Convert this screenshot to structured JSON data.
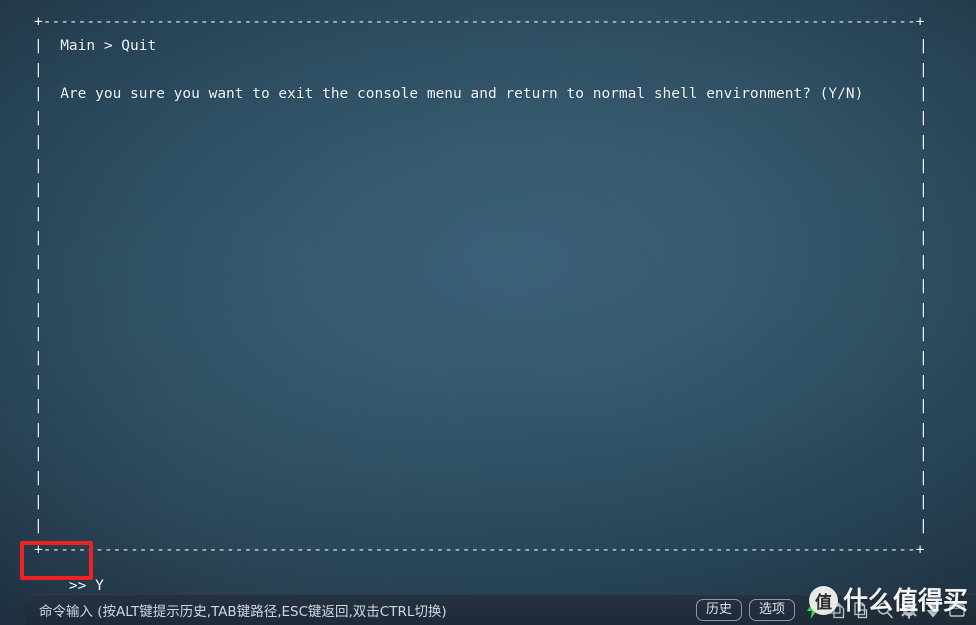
{
  "window": {
    "background_color": "#2e4e62",
    "text_color": "#f4f8fa"
  },
  "console": {
    "border_corner_char": "+",
    "border_horizontal_char": "-",
    "border_vertical_char": "|",
    "top_border": "+---------------------------------------------------------------------------------------------------------+",
    "bottom_border": "+---------------------------------------------------------------------------------------------------------+",
    "breadcrumb": "Main > Quit",
    "question": "Are you sure you want to exit the console menu and return to normal shell environment? (Y/N)",
    "blank_rows_after_question": 18,
    "rows": [
      "Main > Quit",
      "",
      "Are you sure you want to exit the console menu and return to normal shell environment? (Y/N)"
    ]
  },
  "prompt": {
    "symbol": ">>",
    "value": "Y",
    "full_text": ">> Y"
  },
  "annotation": {
    "color": "#ee2222",
    "target": "prompt-line"
  },
  "bottom_bar": {
    "placeholder": "命令输入 (按ALT键提示历史,TAB键路径,ESC键返回,双击CTRL切换)",
    "buttons": [
      {
        "label": "历史",
        "name": "history-button"
      },
      {
        "label": "选项",
        "name": "options-button"
      }
    ],
    "icons": [
      {
        "name": "lightning-icon",
        "color": "#3ddc50"
      },
      {
        "name": "copy-icon",
        "color": "#b9c4cd"
      },
      {
        "name": "paste-icon",
        "color": "#b9c4cd"
      },
      {
        "name": "search-icon",
        "color": "#b9c4cd"
      },
      {
        "name": "gear-icon",
        "color": "#b9c4cd"
      },
      {
        "name": "download-icon",
        "color": "#b9c4cd"
      },
      {
        "name": "window-icon",
        "color": "#b9c4cd"
      }
    ]
  },
  "watermark": {
    "logo_char": "值",
    "text": "什么值得买"
  }
}
